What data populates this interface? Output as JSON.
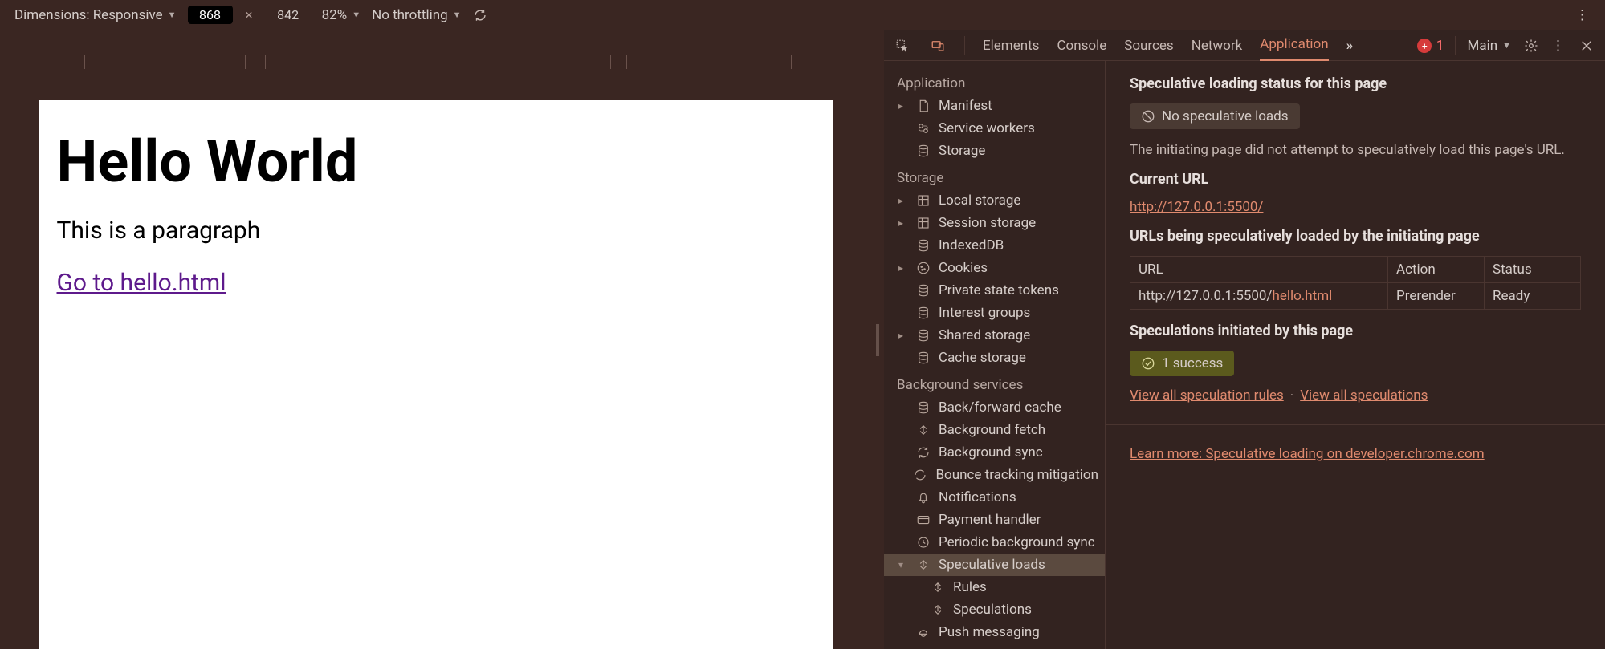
{
  "deviceBar": {
    "dimensionsLabel": "Dimensions: Responsive",
    "width": "868",
    "height": "842",
    "zoom": "82%",
    "throttle": "No throttling"
  },
  "page": {
    "h1": "Hello World",
    "p": "This is a paragraph",
    "link": "Go to hello.html"
  },
  "tabs": {
    "elements": "Elements",
    "console": "Console",
    "sources": "Sources",
    "network": "Network",
    "application": "Application",
    "errorCount": "1",
    "target": "Main"
  },
  "sidebar": {
    "sections": {
      "application": "Application",
      "storage": "Storage",
      "background": "Background services"
    },
    "app": {
      "manifest": "Manifest",
      "serviceWorkers": "Service workers",
      "storage": "Storage"
    },
    "storage": {
      "local": "Local storage",
      "session": "Session storage",
      "indexeddb": "IndexedDB",
      "cookies": "Cookies",
      "privateState": "Private state tokens",
      "interestGroups": "Interest groups",
      "shared": "Shared storage",
      "cache": "Cache storage"
    },
    "bg": {
      "bfcache": "Back/forward cache",
      "bgfetch": "Background fetch",
      "bgsync": "Background sync",
      "bounce": "Bounce tracking mitigation",
      "notif": "Notifications",
      "payment": "Payment handler",
      "periodic": "Periodic background sync",
      "specLoads": "Speculative loads",
      "rules": "Rules",
      "speculations": "Speculations",
      "push": "Push messaging"
    }
  },
  "main": {
    "h_status": "Speculative loading status for this page",
    "pill_noSpeculative": "No speculative loads",
    "desc_noAttempt": "The initiating page did not attempt to speculatively load this page's URL.",
    "h_currentUrl": "Current URL",
    "currentUrl": "http://127.0.0.1:5500/",
    "h_urlsLoaded": "URLs being speculatively loaded by the initiating page",
    "table": {
      "cols": {
        "url": "URL",
        "action": "Action",
        "status": "Status"
      },
      "rows": [
        {
          "urlPrefix": "http://127.0.0.1:5500/",
          "urlHighlight": "hello.html",
          "action": "Prerender",
          "status": "Ready"
        }
      ]
    },
    "h_initiated": "Speculations initiated by this page",
    "pill_success": "1 success",
    "link_viewRules": "View all speculation rules",
    "link_viewSpec": "View all speculations",
    "learnMore": "Learn more: Speculative loading on developer.chrome.com"
  }
}
